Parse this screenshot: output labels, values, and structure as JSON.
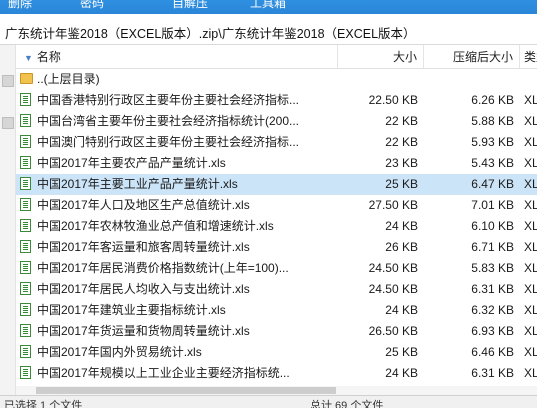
{
  "toolbar": {
    "items": [
      {
        "label": "删除",
        "icon": "delete-icon"
      },
      {
        "label": "密码",
        "icon": "password-icon"
      },
      {
        "label": "自解压",
        "icon": "sfx-icon"
      },
      {
        "label": "工具箱",
        "icon": "toolbox-icon"
      }
    ]
  },
  "path": "广东统计年鉴2018（EXCEL版本）.zip\\广东统计年鉴2018（EXCEL版本）",
  "columns": {
    "name": "名称",
    "size": "大小",
    "compressed": "压缩后大小",
    "type": "类型"
  },
  "parent": {
    "label": "..(上层目录)",
    "icon": "folder-icon"
  },
  "files": [
    {
      "name": "中国香港特别行政区主要年份主要社会经济指标...",
      "size": "22.50 KB",
      "compressed": "6.26 KB",
      "type": "XLS"
    },
    {
      "name": "中国台湾省主要年份主要社会经济指标统计(200...",
      "size": "22 KB",
      "compressed": "5.88 KB",
      "type": "XLS"
    },
    {
      "name": "中国澳门特别行政区主要年份主要社会经济指标...",
      "size": "22 KB",
      "compressed": "5.93 KB",
      "type": "XLS"
    },
    {
      "name": "中国2017年主要农产品产量统计.xls",
      "size": "23 KB",
      "compressed": "5.43 KB",
      "type": "XLS"
    },
    {
      "name": "中国2017年主要工业产品产量统计.xls",
      "size": "25 KB",
      "compressed": "6.47 KB",
      "type": "XLS"
    },
    {
      "name": "中国2017年人口及地区生产总值统计.xls",
      "size": "27.50 KB",
      "compressed": "7.01 KB",
      "type": "XLS"
    },
    {
      "name": "中国2017年农林牧渔业总产值和增速统计.xls",
      "size": "24 KB",
      "compressed": "6.10 KB",
      "type": "XLS"
    },
    {
      "name": "中国2017年客运量和旅客周转量统计.xls",
      "size": "26 KB",
      "compressed": "6.71 KB",
      "type": "XLS"
    },
    {
      "name": "中国2017年居民消费价格指数统计(上年=100)...",
      "size": "24.50 KB",
      "compressed": "5.83 KB",
      "type": "XLS"
    },
    {
      "name": "中国2017年居民人均收入与支出统计.xls",
      "size": "24.50 KB",
      "compressed": "6.31 KB",
      "type": "XLS"
    },
    {
      "name": "中国2017年建筑业主要指标统计.xls",
      "size": "24 KB",
      "compressed": "6.32 KB",
      "type": "XLS"
    },
    {
      "name": "中国2017年货运量和货物周转量统计.xls",
      "size": "26.50 KB",
      "compressed": "6.93 KB",
      "type": "XLS"
    },
    {
      "name": "中国2017年国内外贸易统计.xls",
      "size": "25 KB",
      "compressed": "6.46 KB",
      "type": "XLS"
    },
    {
      "name": "中国2017年规模以上工业企业主要经济指标统...",
      "size": "24 KB",
      "compressed": "6.31 KB",
      "type": "XLS"
    }
  ],
  "selected_index": 4,
  "status": {
    "left": "已选择 1 个文件",
    "right": "总计 69 个文件"
  }
}
